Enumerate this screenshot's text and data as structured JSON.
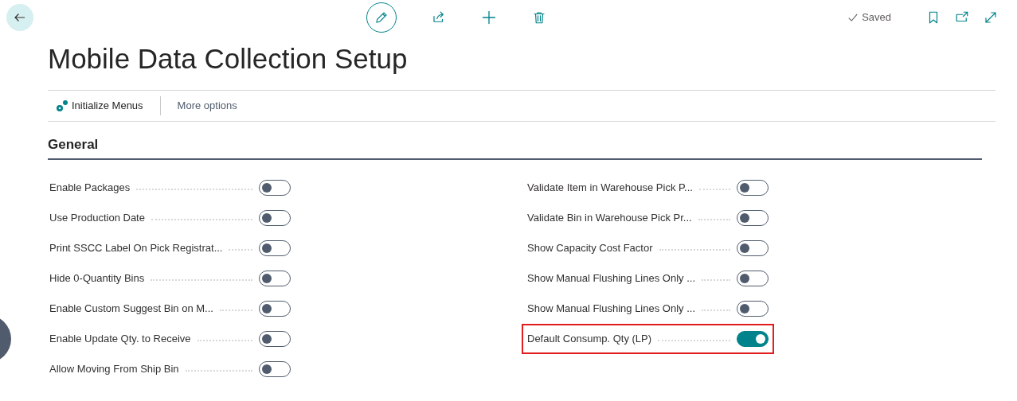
{
  "page": {
    "title": "Mobile Data Collection Setup",
    "status": "Saved"
  },
  "actions": [
    {
      "label": "Initialize Menus",
      "kind": "icon"
    },
    {
      "label": "More options",
      "kind": "plain"
    }
  ],
  "section": {
    "title": "General"
  },
  "columns": [
    [
      {
        "label": "Enable Packages",
        "on": false,
        "highlighted": false
      },
      {
        "label": "Use Production Date",
        "on": false,
        "highlighted": false
      },
      {
        "label": "Print SSCC Label On Pick Registrat...",
        "on": false,
        "highlighted": false
      },
      {
        "label": "Hide 0-Quantity Bins",
        "on": false,
        "highlighted": false
      },
      {
        "label": "Enable Custom Suggest Bin on M...",
        "on": false,
        "highlighted": false
      },
      {
        "label": "Enable Update Qty. to Receive",
        "on": false,
        "highlighted": false
      },
      {
        "label": "Allow Moving From Ship Bin",
        "on": false,
        "highlighted": false
      }
    ],
    [
      {
        "label": "Validate Item in Warehouse Pick P...",
        "on": false,
        "highlighted": false
      },
      {
        "label": "Validate Bin in Warehouse Pick Pr...",
        "on": false,
        "highlighted": false
      },
      {
        "label": "Show Capacity Cost Factor",
        "on": false,
        "highlighted": false
      },
      {
        "label": "Show Manual Flushing Lines Only ...",
        "on": false,
        "highlighted": false
      },
      {
        "label": "Show Manual Flushing Lines Only ...",
        "on": false,
        "highlighted": false
      },
      {
        "label": "Default Consump. Qty (LP)",
        "on": true,
        "highlighted": true
      }
    ]
  ]
}
